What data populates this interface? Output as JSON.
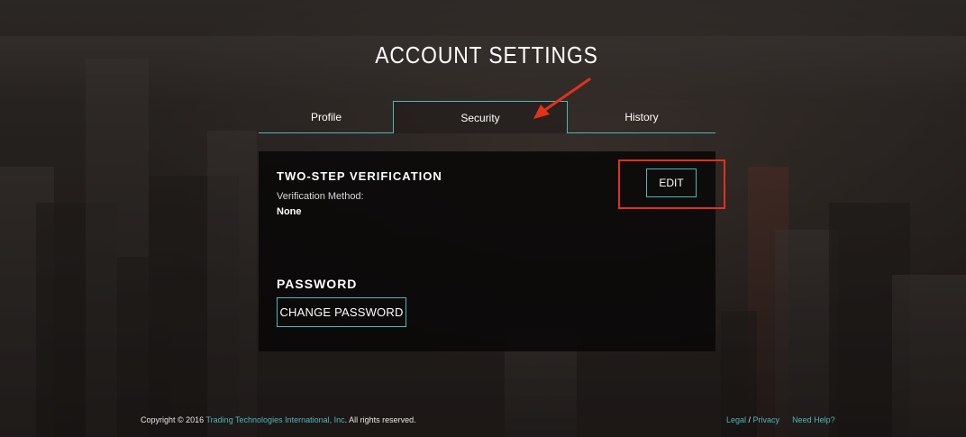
{
  "page": {
    "title": "ACCOUNT SETTINGS"
  },
  "tabs": [
    {
      "label": "Profile",
      "active": false
    },
    {
      "label": "Security",
      "active": true
    },
    {
      "label": "History",
      "active": false
    }
  ],
  "security": {
    "two_step": {
      "heading": "TWO-STEP VERIFICATION",
      "method_label": "Verification Method:",
      "method_value": "None",
      "edit_label": "EDIT"
    },
    "password": {
      "heading": "PASSWORD",
      "change_label": "CHANGE PASSWORD"
    }
  },
  "footer": {
    "copyright_prefix": "Copyright © 2016 ",
    "company_link": "Trading Technologies International, Inc",
    "copyright_suffix": ". All rights reserved.",
    "legal_link": "Legal",
    "separator": " / ",
    "privacy_link": "Privacy",
    "help_link": "Need Help?"
  },
  "colors": {
    "accent": "#4fb6ba",
    "annotation": "#e2321c",
    "panel": "#080707"
  },
  "annotations": {
    "arrow_target": "Security tab",
    "highlight_target": "EDIT button"
  }
}
